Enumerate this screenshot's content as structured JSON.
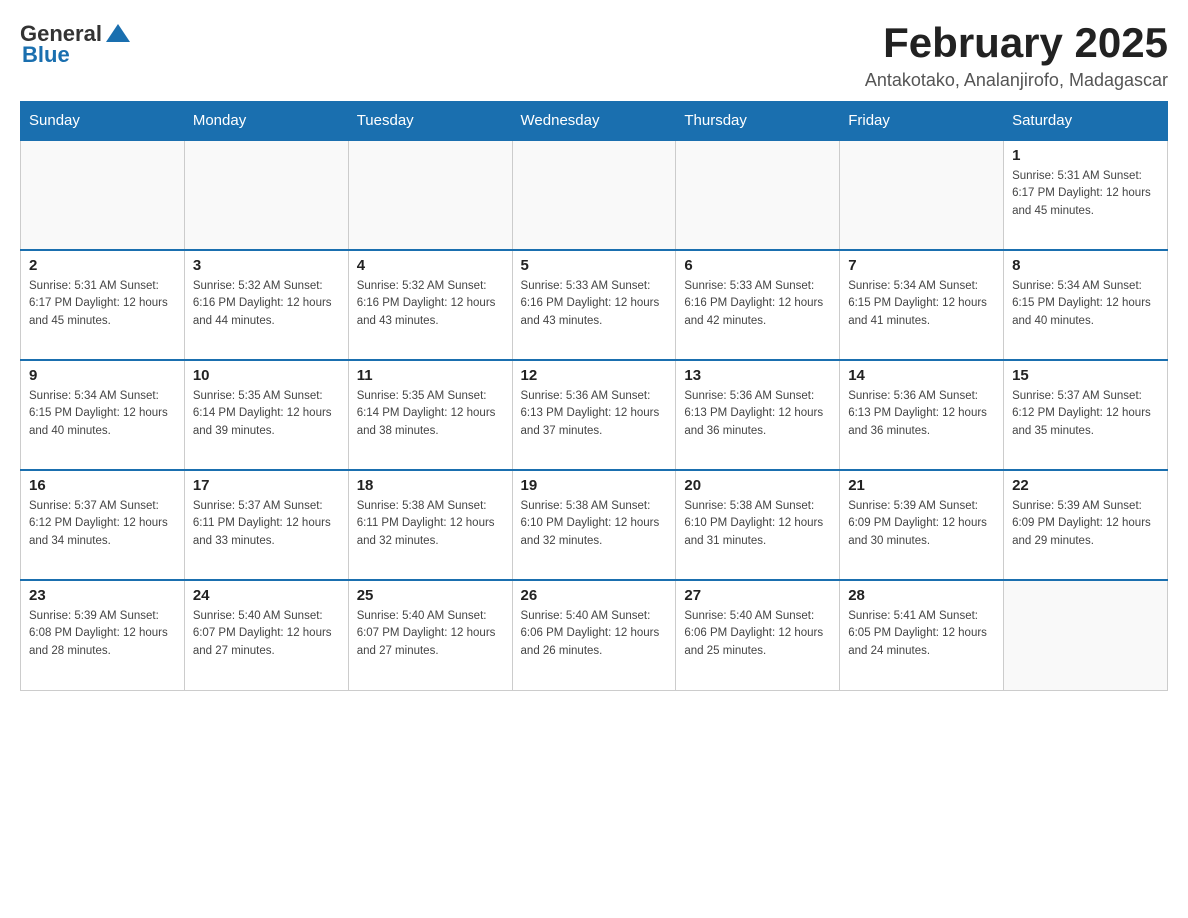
{
  "header": {
    "logo_general": "General",
    "logo_blue": "Blue",
    "month_title": "February 2025",
    "location": "Antakotako, Analanjirofo, Madagascar"
  },
  "weekdays": [
    "Sunday",
    "Monday",
    "Tuesday",
    "Wednesday",
    "Thursday",
    "Friday",
    "Saturday"
  ],
  "weeks": [
    {
      "days": [
        {
          "num": "",
          "info": ""
        },
        {
          "num": "",
          "info": ""
        },
        {
          "num": "",
          "info": ""
        },
        {
          "num": "",
          "info": ""
        },
        {
          "num": "",
          "info": ""
        },
        {
          "num": "",
          "info": ""
        },
        {
          "num": "1",
          "info": "Sunrise: 5:31 AM\nSunset: 6:17 PM\nDaylight: 12 hours and 45 minutes."
        }
      ]
    },
    {
      "days": [
        {
          "num": "2",
          "info": "Sunrise: 5:31 AM\nSunset: 6:17 PM\nDaylight: 12 hours and 45 minutes."
        },
        {
          "num": "3",
          "info": "Sunrise: 5:32 AM\nSunset: 6:16 PM\nDaylight: 12 hours and 44 minutes."
        },
        {
          "num": "4",
          "info": "Sunrise: 5:32 AM\nSunset: 6:16 PM\nDaylight: 12 hours and 43 minutes."
        },
        {
          "num": "5",
          "info": "Sunrise: 5:33 AM\nSunset: 6:16 PM\nDaylight: 12 hours and 43 minutes."
        },
        {
          "num": "6",
          "info": "Sunrise: 5:33 AM\nSunset: 6:16 PM\nDaylight: 12 hours and 42 minutes."
        },
        {
          "num": "7",
          "info": "Sunrise: 5:34 AM\nSunset: 6:15 PM\nDaylight: 12 hours and 41 minutes."
        },
        {
          "num": "8",
          "info": "Sunrise: 5:34 AM\nSunset: 6:15 PM\nDaylight: 12 hours and 40 minutes."
        }
      ]
    },
    {
      "days": [
        {
          "num": "9",
          "info": "Sunrise: 5:34 AM\nSunset: 6:15 PM\nDaylight: 12 hours and 40 minutes."
        },
        {
          "num": "10",
          "info": "Sunrise: 5:35 AM\nSunset: 6:14 PM\nDaylight: 12 hours and 39 minutes."
        },
        {
          "num": "11",
          "info": "Sunrise: 5:35 AM\nSunset: 6:14 PM\nDaylight: 12 hours and 38 minutes."
        },
        {
          "num": "12",
          "info": "Sunrise: 5:36 AM\nSunset: 6:13 PM\nDaylight: 12 hours and 37 minutes."
        },
        {
          "num": "13",
          "info": "Sunrise: 5:36 AM\nSunset: 6:13 PM\nDaylight: 12 hours and 36 minutes."
        },
        {
          "num": "14",
          "info": "Sunrise: 5:36 AM\nSunset: 6:13 PM\nDaylight: 12 hours and 36 minutes."
        },
        {
          "num": "15",
          "info": "Sunrise: 5:37 AM\nSunset: 6:12 PM\nDaylight: 12 hours and 35 minutes."
        }
      ]
    },
    {
      "days": [
        {
          "num": "16",
          "info": "Sunrise: 5:37 AM\nSunset: 6:12 PM\nDaylight: 12 hours and 34 minutes."
        },
        {
          "num": "17",
          "info": "Sunrise: 5:37 AM\nSunset: 6:11 PM\nDaylight: 12 hours and 33 minutes."
        },
        {
          "num": "18",
          "info": "Sunrise: 5:38 AM\nSunset: 6:11 PM\nDaylight: 12 hours and 32 minutes."
        },
        {
          "num": "19",
          "info": "Sunrise: 5:38 AM\nSunset: 6:10 PM\nDaylight: 12 hours and 32 minutes."
        },
        {
          "num": "20",
          "info": "Sunrise: 5:38 AM\nSunset: 6:10 PM\nDaylight: 12 hours and 31 minutes."
        },
        {
          "num": "21",
          "info": "Sunrise: 5:39 AM\nSunset: 6:09 PM\nDaylight: 12 hours and 30 minutes."
        },
        {
          "num": "22",
          "info": "Sunrise: 5:39 AM\nSunset: 6:09 PM\nDaylight: 12 hours and 29 minutes."
        }
      ]
    },
    {
      "days": [
        {
          "num": "23",
          "info": "Sunrise: 5:39 AM\nSunset: 6:08 PM\nDaylight: 12 hours and 28 minutes."
        },
        {
          "num": "24",
          "info": "Sunrise: 5:40 AM\nSunset: 6:07 PM\nDaylight: 12 hours and 27 minutes."
        },
        {
          "num": "25",
          "info": "Sunrise: 5:40 AM\nSunset: 6:07 PM\nDaylight: 12 hours and 27 minutes."
        },
        {
          "num": "26",
          "info": "Sunrise: 5:40 AM\nSunset: 6:06 PM\nDaylight: 12 hours and 26 minutes."
        },
        {
          "num": "27",
          "info": "Sunrise: 5:40 AM\nSunset: 6:06 PM\nDaylight: 12 hours and 25 minutes."
        },
        {
          "num": "28",
          "info": "Sunrise: 5:41 AM\nSunset: 6:05 PM\nDaylight: 12 hours and 24 minutes."
        },
        {
          "num": "",
          "info": ""
        }
      ]
    }
  ]
}
